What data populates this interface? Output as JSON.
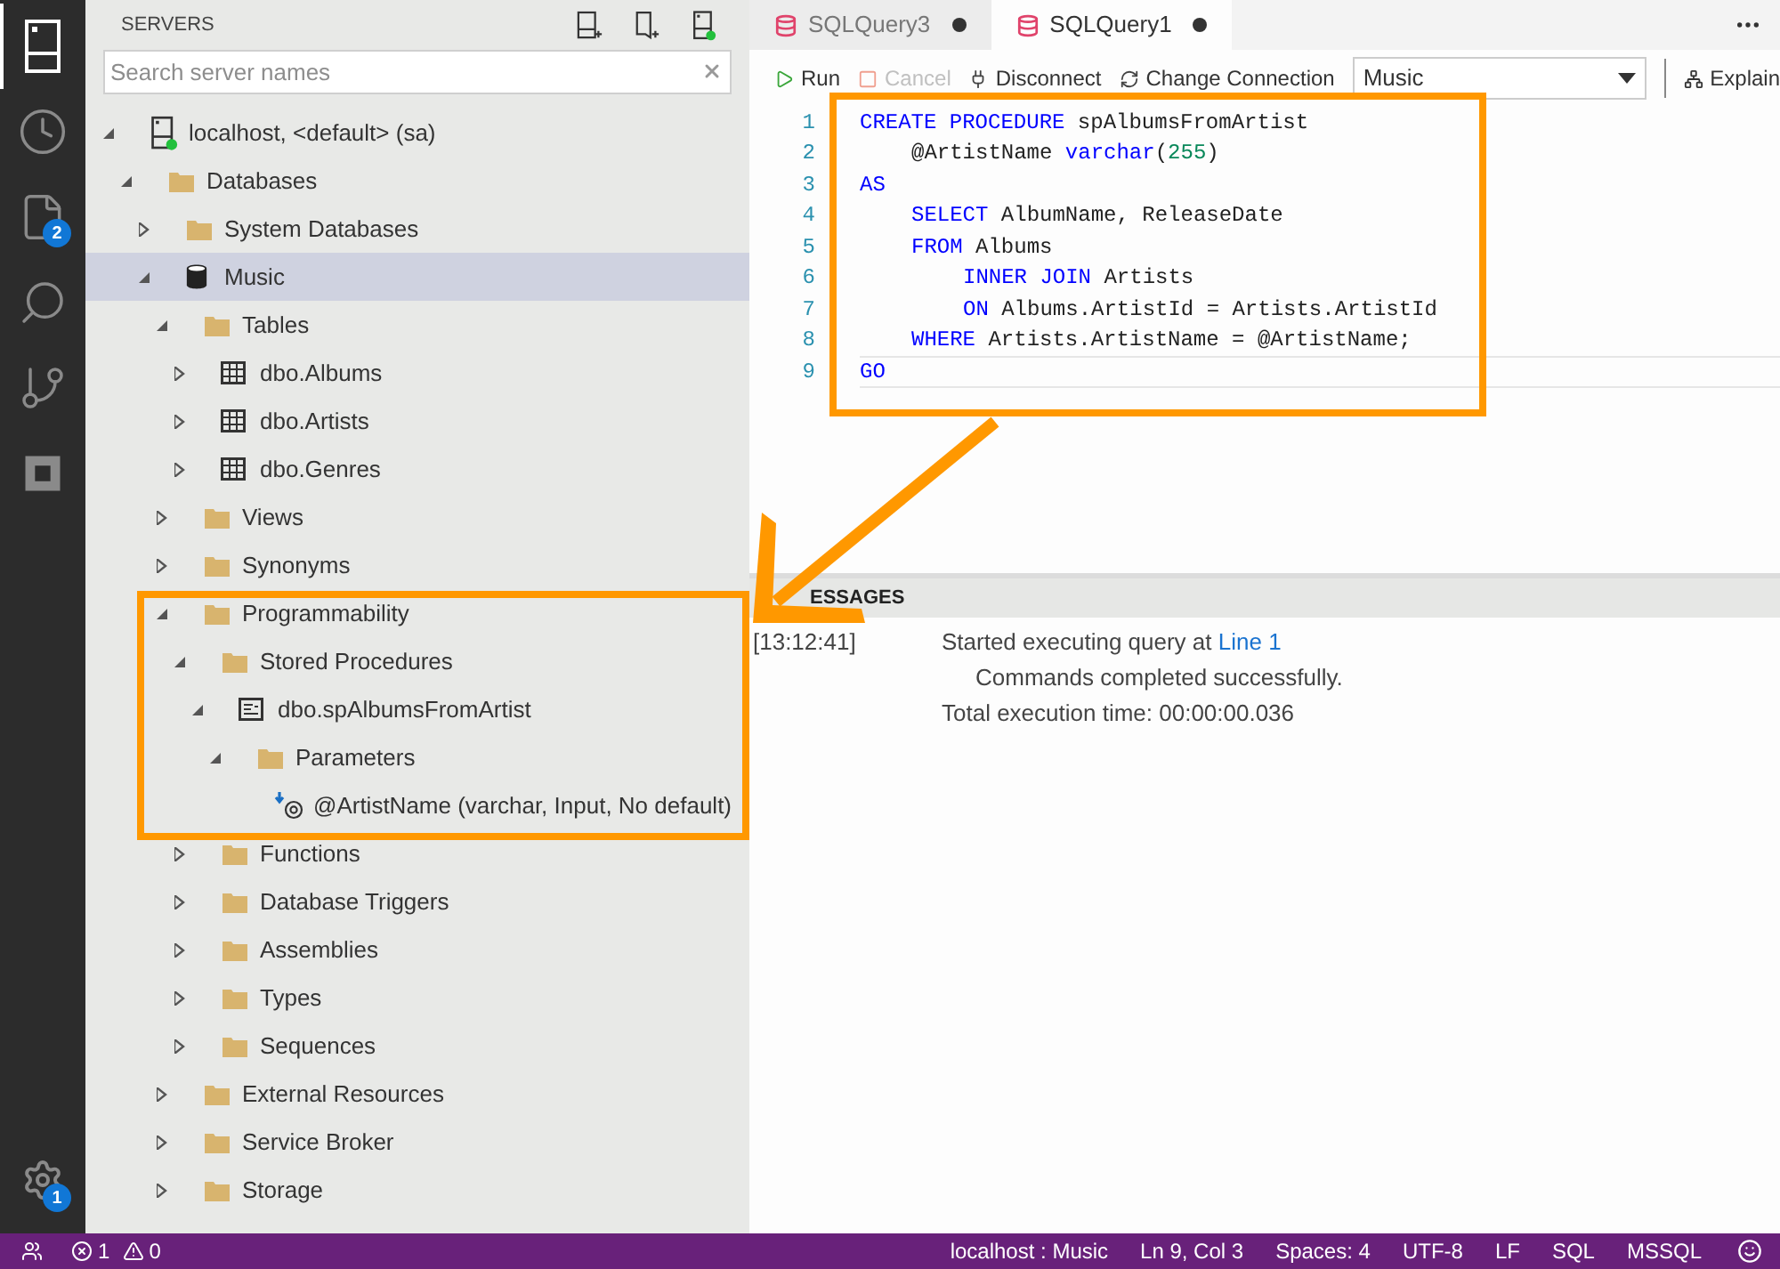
{
  "activity_bar": {
    "items": [
      {
        "kind": "servers",
        "selected": true
      },
      {
        "kind": "history",
        "selected": false
      },
      {
        "kind": "file",
        "selected": false,
        "badge": "2"
      },
      {
        "kind": "search",
        "selected": false
      },
      {
        "kind": "branch",
        "selected": false
      },
      {
        "kind": "extensions",
        "selected": false
      }
    ],
    "settings_badge": "1"
  },
  "sidebar": {
    "title": "SERVERS",
    "search": {
      "placeholder": "Search server names"
    },
    "tree": [
      {
        "label": "localhost, <default> (sa)",
        "kind": "server",
        "expanded": true,
        "selected": false,
        "children": [
          {
            "label": "Databases",
            "kind": "folder",
            "expanded": true,
            "selected": false,
            "children": [
              {
                "label": "System Databases",
                "kind": "folder",
                "expanded": false,
                "selected": false
              },
              {
                "label": "Music",
                "kind": "database",
                "expanded": true,
                "selected": true,
                "children": [
                  {
                    "label": "Tables",
                    "kind": "folder",
                    "expanded": true,
                    "selected": false,
                    "children": [
                      {
                        "label": "dbo.Albums",
                        "kind": "table",
                        "expanded": false,
                        "selected": false
                      },
                      {
                        "label": "dbo.Artists",
                        "kind": "table",
                        "expanded": false,
                        "selected": false
                      },
                      {
                        "label": "dbo.Genres",
                        "kind": "table",
                        "expanded": false,
                        "selected": false
                      }
                    ]
                  },
                  {
                    "label": "Views",
                    "kind": "folder",
                    "expanded": false,
                    "selected": false
                  },
                  {
                    "label": "Synonyms",
                    "kind": "folder",
                    "expanded": false,
                    "selected": false
                  },
                  {
                    "label": "Programmability",
                    "kind": "folder",
                    "expanded": true,
                    "selected": false,
                    "children": [
                      {
                        "label": "Stored Procedures",
                        "kind": "folder",
                        "expanded": true,
                        "selected": false,
                        "children": [
                          {
                            "label": "dbo.spAlbumsFromArtist",
                            "kind": "procedure",
                            "expanded": true,
                            "selected": false,
                            "children": [
                              {
                                "label": "Parameters",
                                "kind": "folder",
                                "expanded": true,
                                "selected": false,
                                "children": [
                                  {
                                    "label": "@ArtistName (varchar, Input, No default)",
                                    "kind": "parameter",
                                    "selected": false
                                  }
                                ]
                              }
                            ]
                          }
                        ]
                      },
                      {
                        "label": "Functions",
                        "kind": "folder",
                        "expanded": false,
                        "selected": false
                      },
                      {
                        "label": "Database Triggers",
                        "kind": "folder",
                        "expanded": false,
                        "selected": false
                      },
                      {
                        "label": "Assemblies",
                        "kind": "folder",
                        "expanded": false,
                        "selected": false
                      },
                      {
                        "label": "Types",
                        "kind": "folder",
                        "expanded": false,
                        "selected": false
                      },
                      {
                        "label": "Sequences",
                        "kind": "folder",
                        "expanded": false,
                        "selected": false
                      }
                    ]
                  },
                  {
                    "label": "External Resources",
                    "kind": "folder",
                    "expanded": false,
                    "selected": false
                  },
                  {
                    "label": "Service Broker",
                    "kind": "folder",
                    "expanded": false,
                    "selected": false
                  },
                  {
                    "label": "Storage",
                    "kind": "folder",
                    "expanded": false,
                    "selected": false
                  }
                ]
              }
            ]
          }
        ]
      }
    ]
  },
  "tabs": [
    {
      "label": "SQLQuery3",
      "selected": false,
      "dirty": true
    },
    {
      "label": "SQLQuery1",
      "selected": true,
      "dirty": true
    }
  ],
  "toolbar": {
    "buttons": [
      {
        "kind": "run",
        "label": "Run",
        "disabled": false
      },
      {
        "kind": "cancel",
        "label": "Cancel",
        "disabled": true
      },
      {
        "kind": "disconnect",
        "label": "Disconnect",
        "disabled": false
      },
      {
        "kind": "change",
        "label": "Change Connection",
        "disabled": false
      }
    ],
    "database": "Music",
    "explain": "Explain"
  },
  "editor": {
    "lines": [
      {
        "number": "1",
        "kind": "top",
        "current": false,
        "tokens": [
          {
            "kind": "keyword",
            "text": "CREATE PROCEDURE"
          },
          {
            "kind": "plain",
            "text": " spAlbumsFromArtist"
          }
        ]
      },
      {
        "number": "2",
        "kind": "inner",
        "current": false,
        "tokens": [
          {
            "kind": "plain",
            "text": "@ArtistName "
          },
          {
            "kind": "keyword",
            "text": "varchar"
          },
          {
            "kind": "plain",
            "text": "("
          },
          {
            "kind": "number",
            "text": "255"
          },
          {
            "kind": "plain",
            "text": ")"
          }
        ]
      },
      {
        "number": "3",
        "kind": "top",
        "current": false,
        "tokens": [
          {
            "kind": "keyword",
            "text": "AS"
          }
        ]
      },
      {
        "number": "4",
        "kind": "inner",
        "current": false,
        "tokens": [
          {
            "kind": "keyword",
            "text": "SELECT"
          },
          {
            "kind": "plain",
            "text": " AlbumName, ReleaseDate"
          }
        ]
      },
      {
        "number": "5",
        "kind": "inner",
        "current": false,
        "tokens": [
          {
            "kind": "keyword",
            "text": "FROM"
          },
          {
            "kind": "plain",
            "text": " Albums"
          }
        ]
      },
      {
        "number": "6",
        "kind": "innermost",
        "current": false,
        "tokens": [
          {
            "kind": "keyword",
            "text": "INNER JOIN"
          },
          {
            "kind": "plain",
            "text": " Artists"
          }
        ]
      },
      {
        "number": "7",
        "kind": "innermost",
        "current": false,
        "tokens": [
          {
            "kind": "keyword",
            "text": "ON"
          },
          {
            "kind": "plain",
            "text": " Albums.ArtistId = Artists.ArtistId"
          }
        ]
      },
      {
        "number": "8",
        "kind": "inner",
        "current": false,
        "tokens": [
          {
            "kind": "keyword",
            "text": "WHERE"
          },
          {
            "kind": "plain",
            "text": " Artists.ArtistName = @ArtistName;"
          }
        ]
      },
      {
        "number": "9",
        "kind": "top",
        "current": true,
        "tokens": [
          {
            "kind": "keyword",
            "text": "GO"
          }
        ]
      }
    ]
  },
  "messages": {
    "title": "ESSAGES",
    "rows": [
      {
        "time": "[13:12:41]",
        "text": "Started executing query at ",
        "link": "Line 1",
        "indent": false
      },
      {
        "text": "Commands completed successfully.",
        "indent": true
      },
      {
        "text": "Total execution time: 00:00:00.036",
        "indent": false
      }
    ]
  },
  "status_bar": {
    "errors": "1",
    "warnings": "0",
    "right": [
      "localhost : Music",
      "Ln 9, Col 3",
      "Spaces: 4",
      "UTF-8",
      "LF",
      "SQL",
      "MSSQL"
    ]
  }
}
